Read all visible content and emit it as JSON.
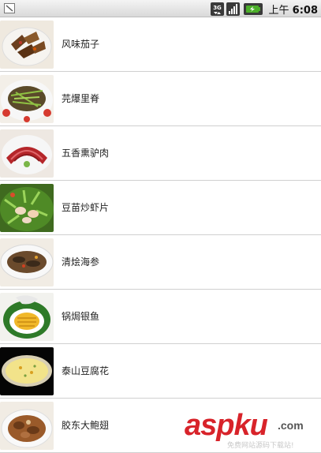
{
  "status_bar": {
    "ampm": "上午",
    "time": "6:08",
    "network_label": "3G",
    "colors": {
      "background": "#e2e2e2",
      "battery": "#4caf2a"
    }
  },
  "list": {
    "items": [
      {
        "label": "风味茄子",
        "image": "dish-photo-eggplant"
      },
      {
        "label": "芫爆里脊",
        "image": "dish-photo-pork-tenderloin"
      },
      {
        "label": "五香熏驴肉",
        "image": "dish-photo-smoked-donkey-meat"
      },
      {
        "label": "豆苗炒虾片",
        "image": "dish-photo-pea-shoots-shrimp"
      },
      {
        "label": "清烩海参",
        "image": "dish-photo-sea-cucumber"
      },
      {
        "label": "锅焗银鱼",
        "image": "dish-photo-silverfish"
      },
      {
        "label": "泰山豆腐花",
        "image": "dish-photo-tofu-pudding"
      },
      {
        "label": "胶东大鲍翅",
        "image": "dish-photo-shark-fin"
      }
    ]
  },
  "watermark": {
    "brand": "asp",
    "brand_suffix": "ku",
    "domain_suffix": ".com",
    "tagline": "免费网站源码下载站!"
  }
}
